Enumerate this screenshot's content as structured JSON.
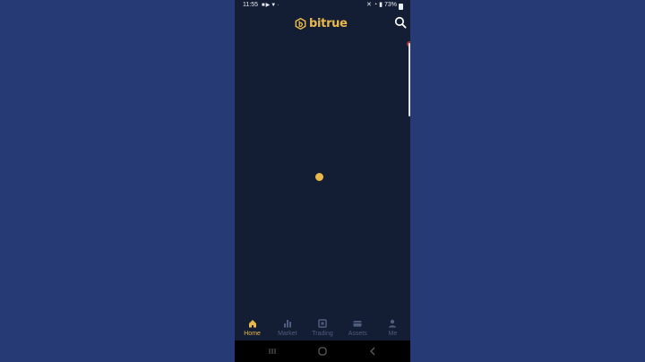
{
  "status_bar": {
    "time": "11:55",
    "left_icons": [
      "video-icon",
      "youtube-icon",
      "download-icon",
      "more-icon"
    ],
    "right_icons": [
      "mute-icon",
      "wifi-icon",
      "signal-icon"
    ],
    "battery": "73%"
  },
  "header": {
    "logo_text": "bitrue",
    "search_icon": "search-icon"
  },
  "content": {
    "loading_indicator": "loading-dot"
  },
  "bottom_nav": {
    "items": [
      {
        "label": "Home",
        "icon": "home-icon",
        "active": true
      },
      {
        "label": "Market",
        "icon": "market-icon",
        "active": false
      },
      {
        "label": "Trading",
        "icon": "trading-icon",
        "active": false
      },
      {
        "label": "Assets",
        "icon": "assets-icon",
        "active": false
      },
      {
        "label": "Me",
        "icon": "me-icon",
        "active": false
      }
    ]
  },
  "system_nav": [
    "recent-apps-icon",
    "home-button-icon",
    "back-icon"
  ],
  "colors": {
    "background": "#263a75",
    "app_background": "#131d33",
    "accent": "#e9b84a",
    "inactive": "#4f5e7e"
  }
}
